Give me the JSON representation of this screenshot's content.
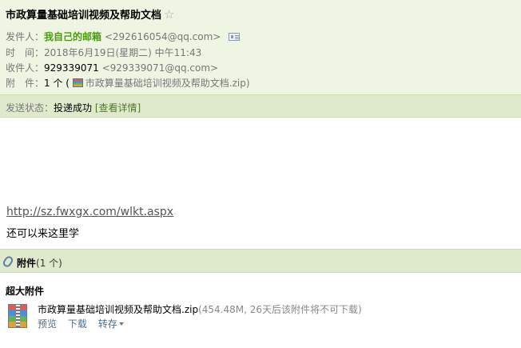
{
  "header": {
    "subject": "市政算量基础培训视频及帮助文档",
    "star_icon": "☆",
    "sender": {
      "label": "发件人：",
      "name": "我自己的邮箱",
      "address": "<292616054@qq.com>"
    },
    "time": {
      "label": "时　间：",
      "value": "2018年6月19日(星期二) 中午11:43"
    },
    "recipient": {
      "label": "收件人：",
      "name": "929339071",
      "address": "<929339071@qq.com>"
    },
    "attachment": {
      "label": "附　件：",
      "count_prefix": "1 个 (",
      "file": "市政算量基础培训视频及帮助文档.zip",
      "suffix": ")"
    },
    "status": {
      "label": "发送状态：",
      "value": "投递成功",
      "details": "[查看详情]"
    }
  },
  "body": {
    "link": "http://sz.fwxgx.com/wlkt.aspx",
    "text": "还可以来这里学"
  },
  "attachments": {
    "title": "附件",
    "count": "(1 个)",
    "big_title": "超大附件",
    "file_name": "市政算量基础培训视频及帮助文档.zip",
    "file_meta": "(454.48M, 26天后该附件将不可下载)",
    "actions": {
      "preview": "预览",
      "download": "下载",
      "save": "转存"
    }
  },
  "colors": {
    "header_bg": "#eef5e3",
    "bar_bg": "#dfeacc",
    "sender_green": "#4d9a11"
  }
}
